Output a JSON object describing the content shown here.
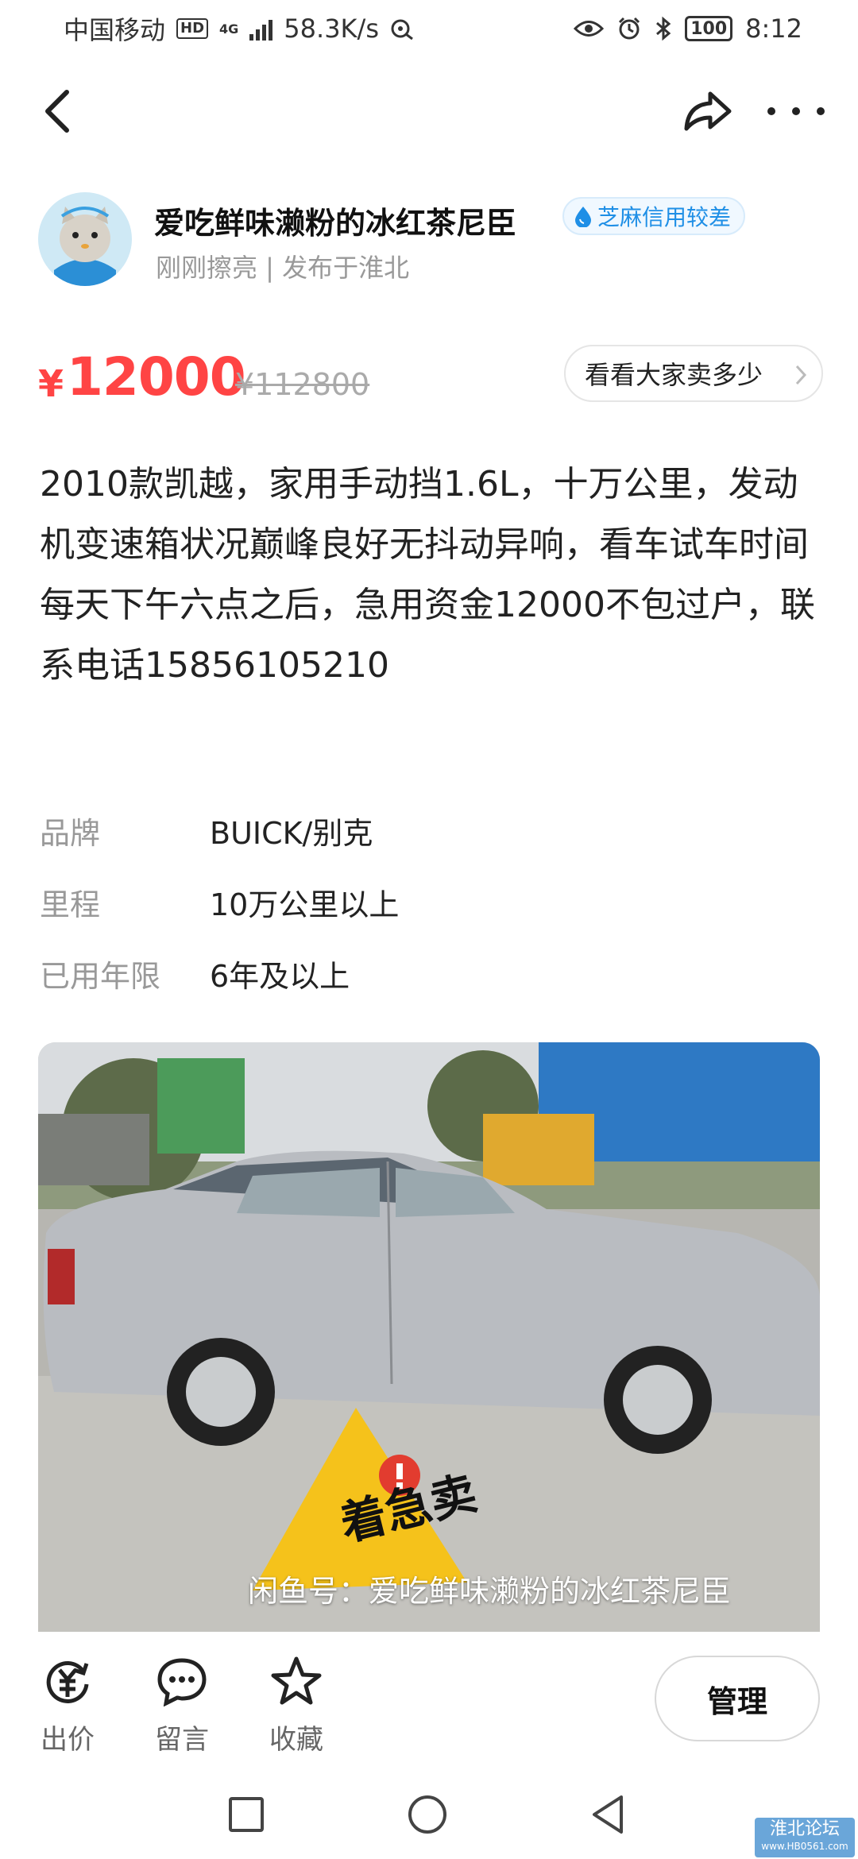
{
  "status_bar": {
    "carrier": "中国移动",
    "hd": "HD",
    "network": "4G",
    "speed": "58.3K/s",
    "battery": "100",
    "time": "8:12"
  },
  "seller": {
    "name": "爱吃鲜味濑粉的冰红茶尼臣",
    "credit_badge": "芝麻信用较差",
    "subtitle": "刚刚擦亮 | 发布于淮北"
  },
  "price": {
    "currency": "¥",
    "current": "12000",
    "original": "¥112800",
    "compare_button": "看看大家卖多少"
  },
  "description": "2010款凯越，家用手动挡1.6L，十万公里，发动机变速箱状况巅峰良好无抖动异响，看车试车时间每天下午六点之后，急用资金12000不包过户，联系电话15856105210",
  "specs": [
    {
      "key": "品牌",
      "value": "BUICK/别克"
    },
    {
      "key": "里程",
      "value": "10万公里以上"
    },
    {
      "key": "已用年限",
      "value": "6年及以上"
    }
  ],
  "photo": {
    "sticker_text": "着急卖",
    "caption": "闲鱼号：爱吃鲜味濑粉的冰红茶尼臣"
  },
  "actions": {
    "offer": "出价",
    "comment": "留言",
    "favorite": "收藏",
    "manage": "管理"
  },
  "watermark": {
    "text": "淮北论坛",
    "url": "www.HB0561.com"
  },
  "colors": {
    "price_red": "#ff4444",
    "credit_blue": "#1f8fe6",
    "muted_text": "#999999"
  }
}
